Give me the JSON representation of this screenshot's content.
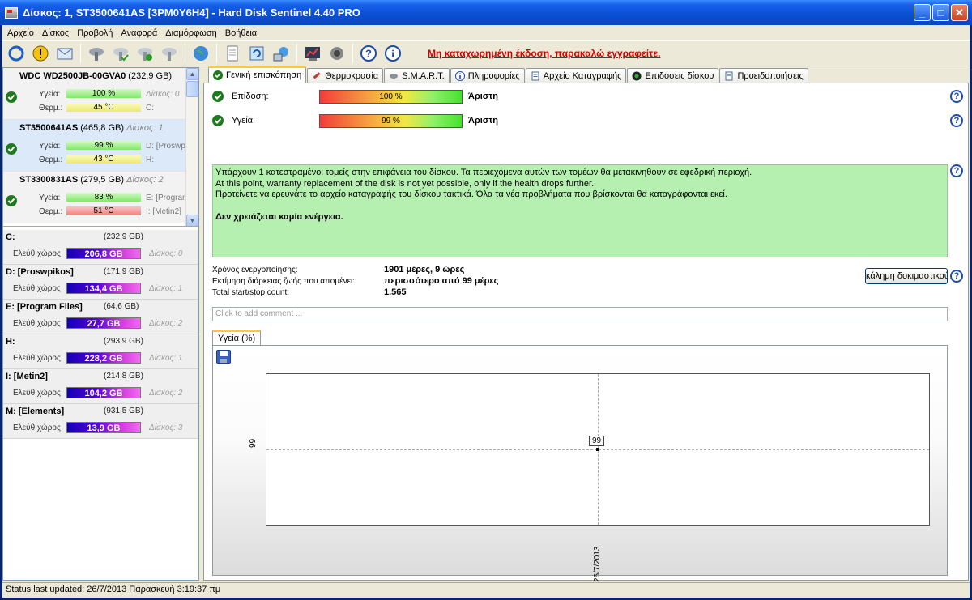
{
  "window": {
    "title": "Δίσκος: 1, ST3500641AS [3PM0Y6H4]  -  Hard Disk Sentinel 4.40 PRO",
    "btn_min": "_",
    "btn_max": "□",
    "btn_close": "✕"
  },
  "menu": [
    "Αρχείο",
    "Δίσκος",
    "Προβολή",
    "Αναφορά",
    "Διαμόρφωση",
    "Βοήθεια"
  ],
  "toolbar": {
    "warning": "Μη καταχωρημένη έκδοση, παρακαλώ εγγραφείτε.",
    "icons": [
      "refresh-icon",
      "alert-icon",
      "mail-icon",
      "disk-icon",
      "disk-check-icon",
      "disk-ok-icon",
      "disk-info-icon",
      "globe-icon",
      "document-icon",
      "sync-icon",
      "network-icon",
      "report-icon",
      "speaker-icon",
      "help-icon",
      "info-icon"
    ]
  },
  "disks": [
    {
      "name": "WDC WD2500JB-00GVA0",
      "size": "(232,9 GB)",
      "num": "Δίσκος: 0",
      "health_label": "Υγεία:",
      "health": "100 %",
      "temp_label": "Θερμ.:",
      "temp": "45 °C",
      "hot": false,
      "drive1": "Δίσκος: 0",
      "drive2": "C:",
      "drive1_italic": true
    },
    {
      "name": "ST3500641AS",
      "size": "(465,8 GB)",
      "num": "Δίσκος: 1",
      "health_label": "Υγεία:",
      "health": "99 %",
      "temp_label": "Θερμ.:",
      "temp": "43 °C",
      "hot": false,
      "drive1": "D: [Proswp",
      "drive2": "H:",
      "drive1_italic": false
    },
    {
      "name": "ST3300831AS",
      "size": "(279,5 GB)",
      "num": "Δίσκος: 2",
      "health_label": "Υγεία:",
      "health": "83 %",
      "temp_label": "Θερμ.:",
      "temp": "51 °C",
      "hot": true,
      "drive1": "E: [Program",
      "drive2": "I: [Metin2]",
      "drive1_italic": false
    }
  ],
  "partitions": [
    {
      "name": "C:",
      "size": "(232,9 GB)",
      "free_label": "Ελεύθ χώρος",
      "free": "206,8 GB",
      "disk": "Δίσκος: 0"
    },
    {
      "name": "D: [Proswpikos]",
      "size": "(171,9 GB)",
      "free_label": "Ελεύθ χώρος",
      "free": "134,4 GB",
      "disk": "Δίσκος: 1"
    },
    {
      "name": "E: [Program Files]",
      "size": "(64,6 GB)",
      "free_label": "Ελεύθ χώρος",
      "free": "27,7 GB",
      "disk": "Δίσκος: 2"
    },
    {
      "name": "H:",
      "size": "(293,9 GB)",
      "free_label": "Ελεύθ χώρος",
      "free": "228,2 GB",
      "disk": "Δίσκος: 1"
    },
    {
      "name": "I: [Metin2]",
      "size": "(214,8 GB)",
      "free_label": "Ελεύθ χώρος",
      "free": "104,2 GB",
      "disk": "Δίσκος: 2"
    },
    {
      "name": "M: [Elements]",
      "size": "(931,5 GB)",
      "free_label": "Ελεύθ χώρος",
      "free": "13,9 GB",
      "disk": "Δίσκος: 3"
    }
  ],
  "tabs": [
    {
      "label": "Γενική επισκόπηση",
      "icon": "check-circle-icon"
    },
    {
      "label": "Θερμοκρασία",
      "icon": "thermometer-icon"
    },
    {
      "label": "S.M.A.R.T.",
      "icon": "smart-icon"
    },
    {
      "label": "Πληροφορίες",
      "icon": "info-icon"
    },
    {
      "label": "Αρχείο Καταγραφής",
      "icon": "log-icon"
    },
    {
      "label": "Επιδόσεις δίσκου",
      "icon": "gauge-icon"
    },
    {
      "label": "Προειδοποιήσεις",
      "icon": "warnings-icon"
    }
  ],
  "overview": {
    "performance_label": "Επίδοση:",
    "performance_value": "100 %",
    "performance_rating": "Άριστη",
    "health_label": "Υγεία:",
    "health_value": "99 %",
    "health_rating": "Άριστη",
    "message_line1": "Υπάρχουν 1 κατεστραμένοι τομείς στην επιφάνεια του δίσκου. Τα περιεχόμενα αυτών των τομέων θα μετακινηθούν σε εφεδρική περιοχή.",
    "message_line2": "At this point, warranty replacement of the disk is not yet possible, only if the health drops further.",
    "message_line3": "Προτείνετε να ερευνάτε το αρχείο καταγραφής του δίσκου τακτικά. Όλα τα νέα προβλήματα που βρίσκονται θα καταγράφονται εκεί.",
    "message_action": "Δεν χρειάζεται καμία ενέργεια.",
    "uptime_label": "Χρόνος ενεργοποίησης:",
    "uptime_value": "1901 μέρες, 9 ώρες",
    "lifetime_label": "Εκτίμηση διάρκειας ζωής που απομένει:",
    "lifetime_value": "περισσότερο από 99 μέρες",
    "startstop_label": "Total start/stop count:",
    "startstop_value": "1.565",
    "test_button": "κάλημη δοκιμαστικού",
    "comment_placeholder": "Click to add comment ...",
    "help": "?"
  },
  "chart_tab": "Υγεία (%)",
  "chart_data": {
    "type": "line",
    "x": [
      "26/7/2013"
    ],
    "series": [
      {
        "values": [
          99
        ]
      }
    ],
    "title": "",
    "xlabel": "",
    "ylabel": "",
    "yticks": [
      "99"
    ],
    "data_labels": [
      "99"
    ],
    "grid": true
  },
  "status": {
    "text": "Status last updated: 26/7/2013 Παρασκευή 3:19:37 πμ"
  }
}
